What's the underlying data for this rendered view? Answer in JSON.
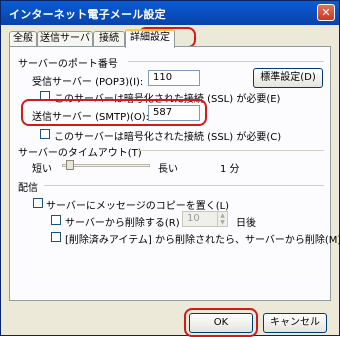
{
  "window": {
    "title": "インターネット電子メール設定",
    "close_glyph": "✕"
  },
  "tabs": [
    "全般",
    "送信サーバー",
    "接続",
    "詳細設定"
  ],
  "server_ports": {
    "heading": "サーバーのポート番号",
    "incoming_label": "受信サーバー (POP3)(I):",
    "incoming_value": "110",
    "defaults_button": "標準設定(D)",
    "incoming_ssl_label": "このサーバーは暗号化された接続 (SSL) が必要(E)",
    "outgoing_label": "送信サーバー (SMTP)(O):",
    "outgoing_value": "587",
    "outgoing_ssl_label": "このサーバーは暗号化された接続 (SSL) が必要(C)"
  },
  "timeout": {
    "heading": "サーバーのタイムアウト(T)",
    "short_label": "短い",
    "long_label": "長い",
    "value": "1 分",
    "slider_level": 0.05
  },
  "delivery": {
    "heading": "配信",
    "leave_copy_label": "サーバーにメッセージのコピーを置く(L)",
    "remove_after_label": "サーバーから削除する(R)",
    "remove_after_days": "10",
    "days_label": "日後",
    "remove_deleted_label": "[削除済みアイテム] から削除されたら、サーバーから削除(M)"
  },
  "footer": {
    "ok": "OK",
    "cancel": "キャンセル"
  }
}
